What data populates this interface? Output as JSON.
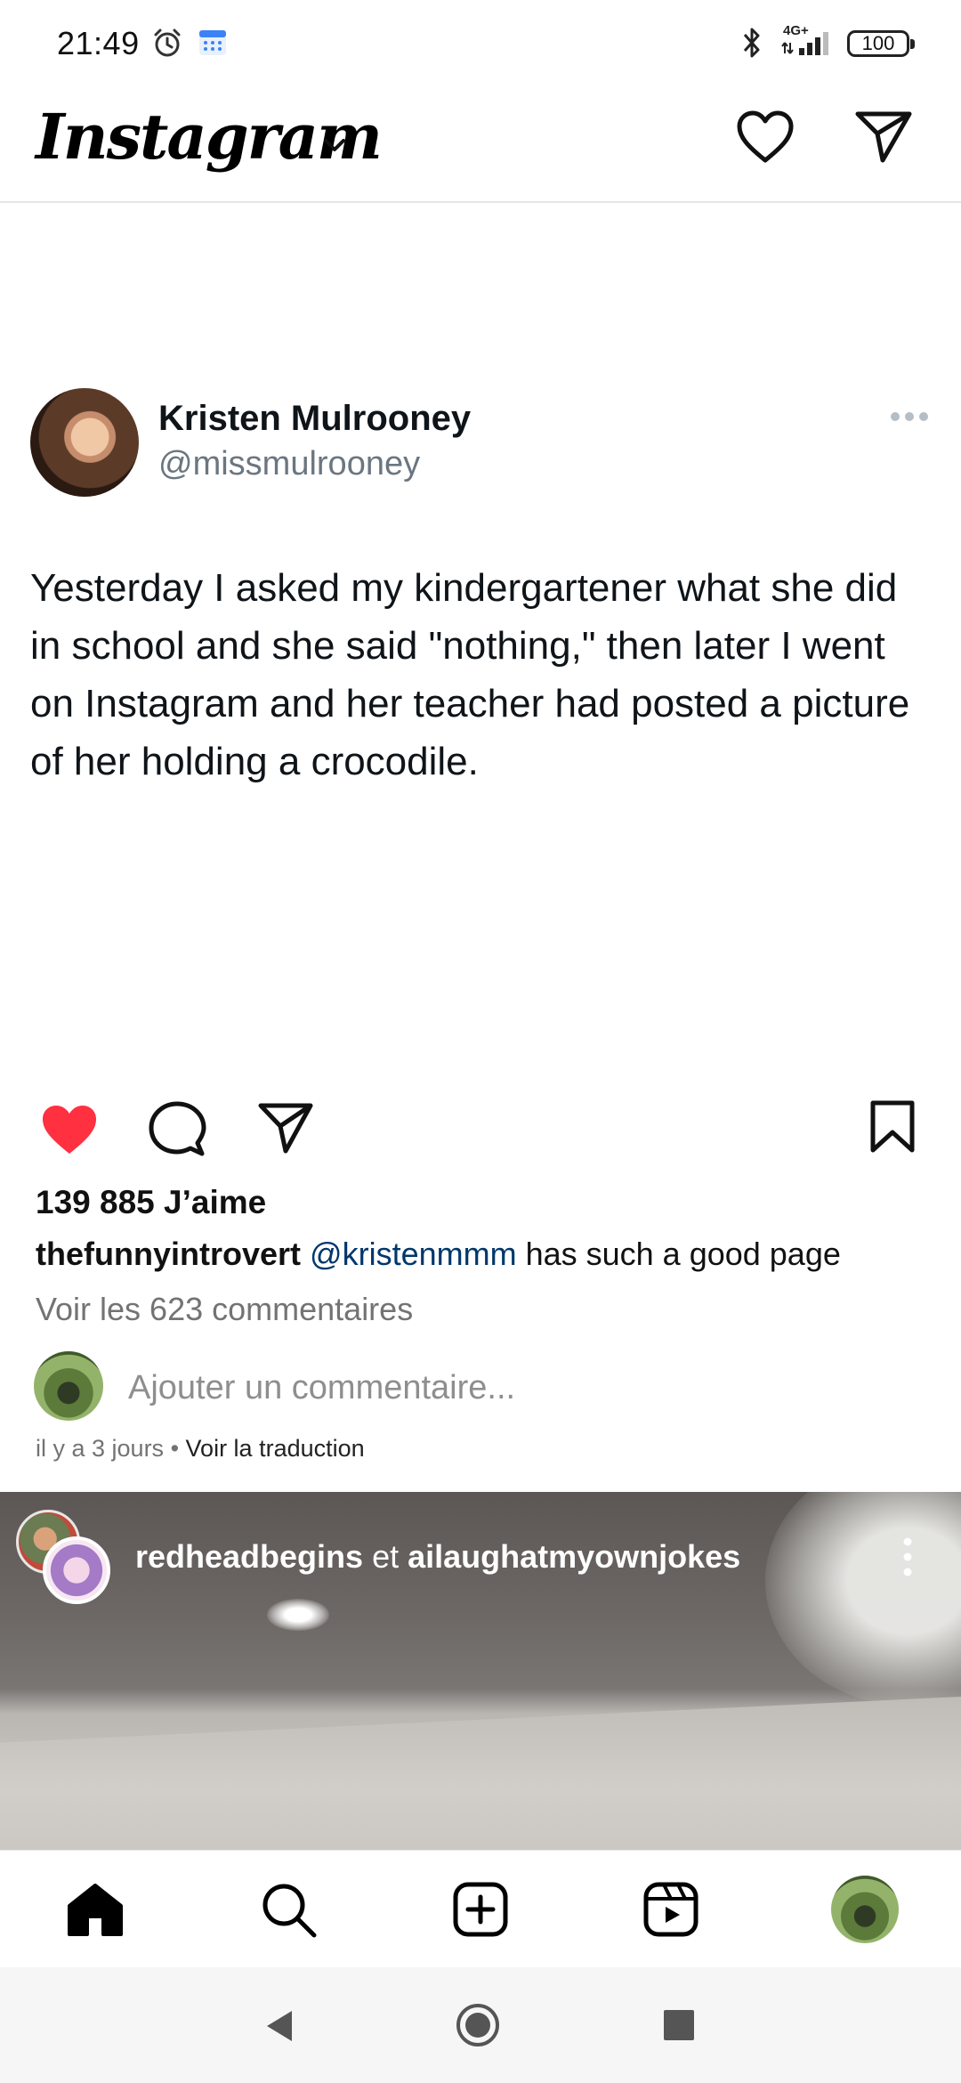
{
  "status_bar": {
    "time": "21:49",
    "network": "4G+",
    "battery": "100",
    "icons": [
      "alarm-icon",
      "calendar-icon",
      "bluetooth-icon",
      "signal-icon",
      "battery-icon"
    ]
  },
  "header": {
    "logo": "Instagram",
    "icons": [
      "chevron-down-icon",
      "heart-icon",
      "direct-send-icon"
    ]
  },
  "tweet": {
    "name": "Kristen Mulrooney",
    "handle": "@missmulrooney",
    "text": "Yesterday I asked my kindergartener what she did in school and she said \"nothing,\" then later I went on Instagram and her teacher had posted a picture of her holding a crocodile."
  },
  "post": {
    "liked": true,
    "like_color": "#ff3040",
    "likes": "139 885 J’aime",
    "caption_user": "thefunnyintrovert",
    "caption_mention": "@kristenmmm",
    "caption_text": " has such a good page",
    "view_comments": "Voir les 623 commentaires",
    "add_comment_placeholder": "Ajouter un commentaire...",
    "time_ago": "il y a 3 jours",
    "separator": " • ",
    "translate": "Voir la traduction"
  },
  "next_post": {
    "user1": "redheadbegins",
    "joiner": " et ",
    "user2": "ailaughatmyownjokes"
  },
  "bottom_nav": {
    "items": [
      "home-icon",
      "search-icon",
      "create-icon",
      "reels-icon",
      "profile-avatar"
    ]
  },
  "system_nav": {
    "items": [
      "back-icon",
      "home-circle-icon",
      "recents-icon"
    ]
  }
}
